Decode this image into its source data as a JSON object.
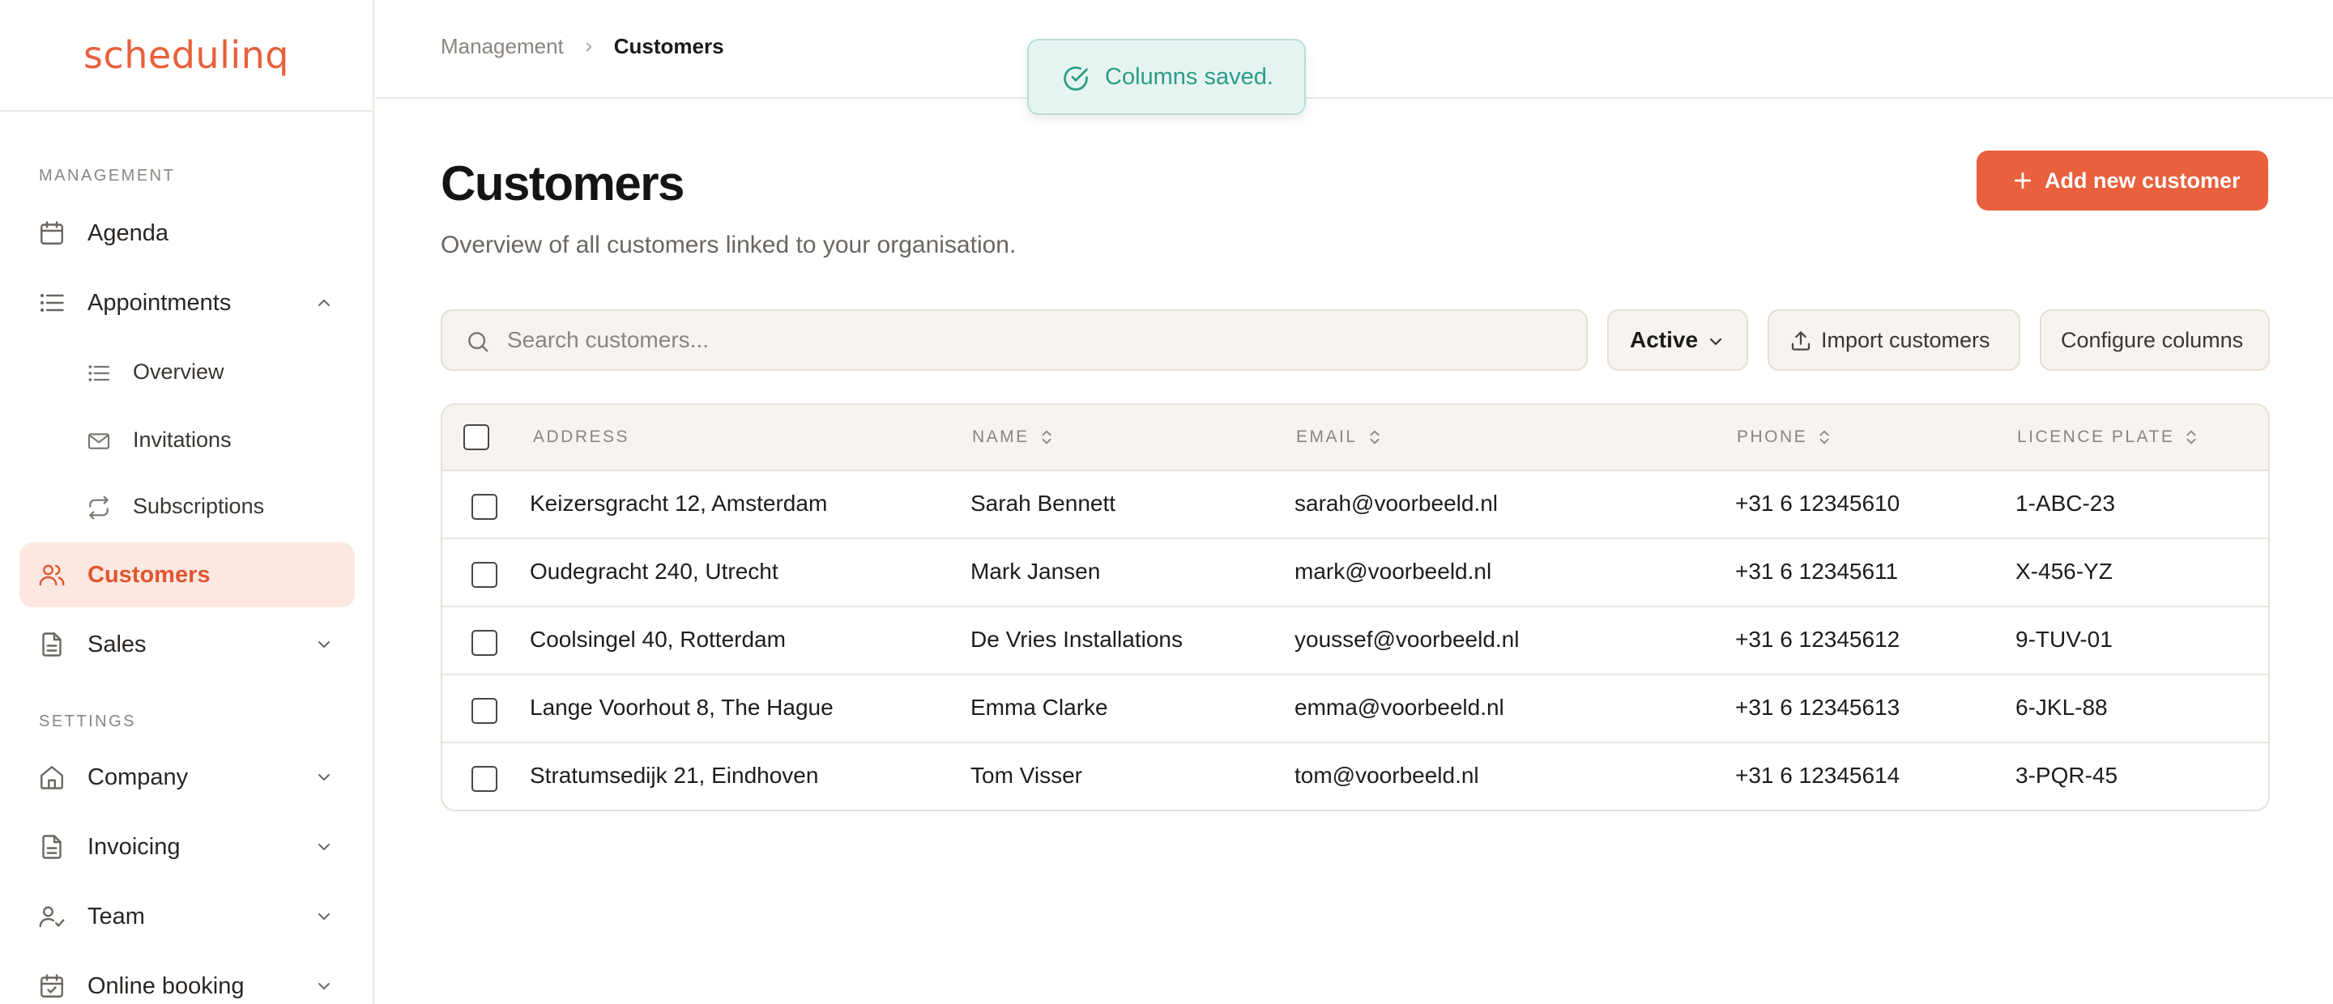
{
  "app": {
    "logo": "schedulinq"
  },
  "sidebar": {
    "management_label": "MANAGEMENT",
    "settings_label": "SETTINGS",
    "items": {
      "agenda": "Agenda",
      "appointments": "Appointments",
      "overview": "Overview",
      "invitations": "Invitations",
      "subscriptions": "Subscriptions",
      "customers": "Customers",
      "sales": "Sales",
      "company": "Company",
      "invoicing": "Invoicing",
      "team": "Team",
      "online_booking": "Online booking"
    }
  },
  "breadcrumb": {
    "parent": "Management",
    "current": "Customers"
  },
  "toast": {
    "message": "Columns saved."
  },
  "page": {
    "title": "Customers",
    "subtitle": "Overview of all customers linked to your organisation.",
    "add_button": "Add new customer"
  },
  "toolbar": {
    "search_placeholder": "Search customers...",
    "status_filter": "Active",
    "import_button": "Import customers",
    "configure_button": "Configure columns"
  },
  "table": {
    "headers": {
      "address": "ADDRESS",
      "name": "NAME",
      "email": "EMAIL",
      "phone": "PHONE",
      "plate": "LICENCE PLATE"
    },
    "rows": [
      {
        "address": "Keizersgracht 12, Amsterdam",
        "name": "Sarah Bennett",
        "email": "sarah@voorbeeld.nl",
        "phone": "+31 6 12345610",
        "plate": "1-ABC-23"
      },
      {
        "address": "Oudegracht 240, Utrecht",
        "name": "Mark Jansen",
        "email": "mark@voorbeeld.nl",
        "phone": "+31 6 12345611",
        "plate": "X-456-YZ"
      },
      {
        "address": "Coolsingel 40, Rotterdam",
        "name": "De Vries Installations",
        "email": "youssef@voorbeeld.nl",
        "phone": "+31 6 12345612",
        "plate": "9-TUV-01"
      },
      {
        "address": "Lange Voorhout 8, The Hague",
        "name": "Emma Clarke",
        "email": "emma@voorbeeld.nl",
        "phone": "+31 6 12345613",
        "plate": "6-JKL-88"
      },
      {
        "address": "Stratumsedijk 21, Eindhoven",
        "name": "Tom Visser",
        "email": "tom@voorbeeld.nl",
        "phone": "+31 6 12345614",
        "plate": "3-PQR-45"
      }
    ]
  },
  "colors": {
    "accent": "#e8603c",
    "accent_soft": "#fde8e1",
    "success": "#2a9d86",
    "muted": "#8a8580"
  }
}
